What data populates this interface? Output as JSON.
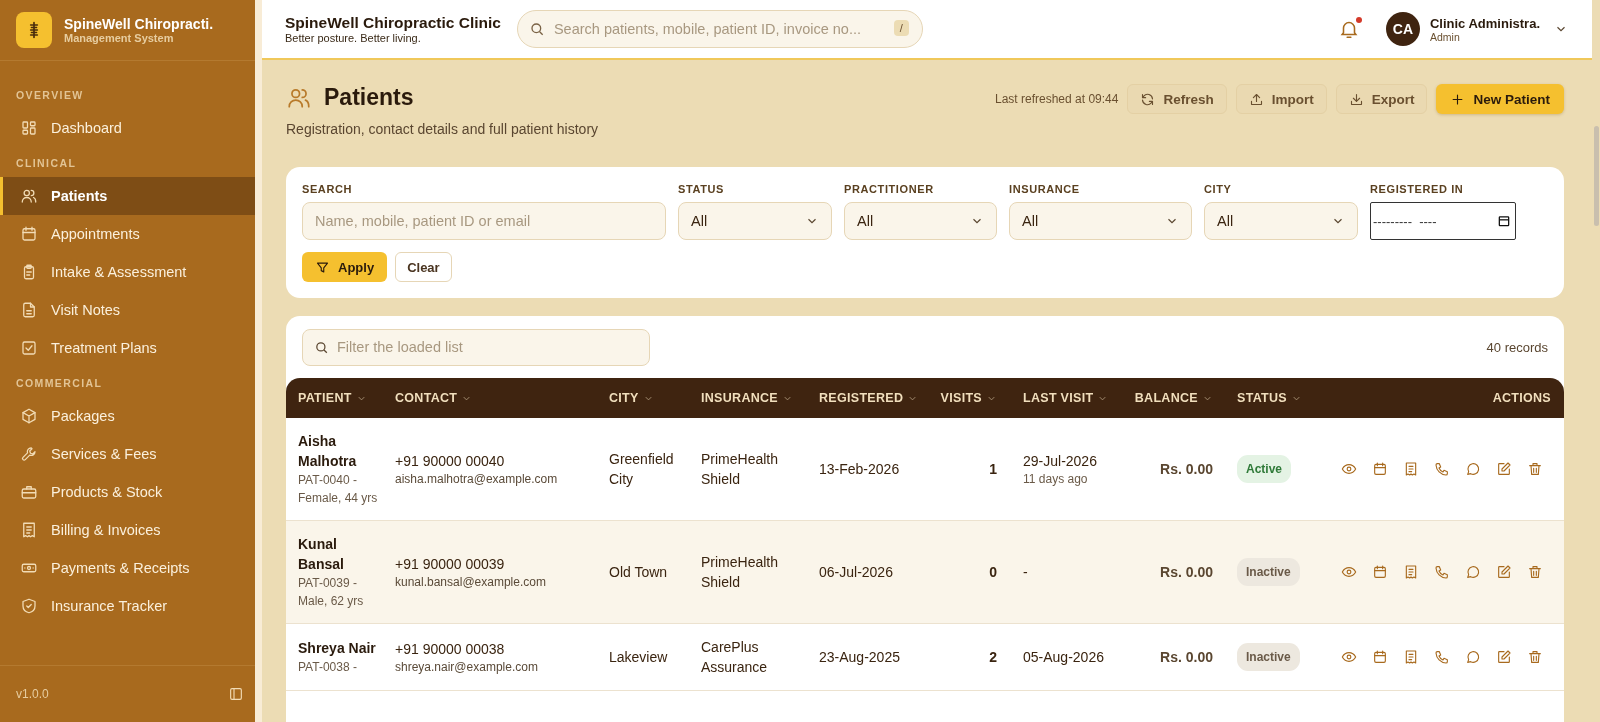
{
  "sidebar": {
    "brand": {
      "title": "SpineWell Chiropracti.",
      "subtitle": "Management System"
    },
    "sections": [
      {
        "heading": "OVERVIEW",
        "items": [
          {
            "label": "Dashboard",
            "selected": false
          }
        ]
      },
      {
        "heading": "CLINICAL",
        "items": [
          {
            "label": "Patients",
            "selected": true
          },
          {
            "label": "Appointments",
            "selected": false
          },
          {
            "label": "Intake & Assessment",
            "selected": false
          },
          {
            "label": "Visit Notes",
            "selected": false
          },
          {
            "label": "Treatment Plans",
            "selected": false
          }
        ]
      },
      {
        "heading": "COMMERCIAL",
        "items": [
          {
            "label": "Packages",
            "selected": false
          },
          {
            "label": "Services & Fees",
            "selected": false
          },
          {
            "label": "Products & Stock",
            "selected": false
          },
          {
            "label": "Billing & Invoices",
            "selected": false
          },
          {
            "label": "Payments & Receipts",
            "selected": false
          },
          {
            "label": "Insurance Tracker",
            "selected": false
          }
        ]
      }
    ],
    "version": "v1.0.0"
  },
  "topbar": {
    "clinic_name": "SpineWell Chiropractic Clinic",
    "tagline": "Better posture. Better living.",
    "search": {
      "placeholder": "Search patients, mobile, patient ID, invoice no...",
      "shortcut": "/"
    },
    "notification_dot": true,
    "user": {
      "initials": "CA",
      "name": "Clinic Administra.",
      "role": "Admin"
    }
  },
  "page": {
    "title": "Patients",
    "subtitle": "Registration, contact details and full patient history",
    "last_refreshed": "Last refreshed at 09:44",
    "actions": [
      {
        "label": "Refresh",
        "kind": "refresh"
      },
      {
        "label": "Import",
        "kind": "import"
      },
      {
        "label": "Export",
        "kind": "export"
      },
      {
        "label": "New Patient",
        "kind": "primary"
      }
    ]
  },
  "filters": {
    "search": {
      "label": "SEARCH",
      "placeholder": "Name, mobile, patient ID or email"
    },
    "selects": [
      {
        "label": "STATUS",
        "value": "All"
      },
      {
        "label": "PRACTITIONER",
        "value": "All"
      },
      {
        "label": "INSURANCE",
        "value": "All"
      },
      {
        "label": "CITY",
        "value": "All"
      }
    ],
    "date": {
      "label": "REGISTERED IN",
      "value": "---------  ----"
    },
    "apply": "Apply",
    "clear": "Clear"
  },
  "list": {
    "filter_placeholder": "Filter the loaded list",
    "count": "40 records",
    "columns": [
      {
        "label": "PATIENT",
        "sortable": true
      },
      {
        "label": "CONTACT",
        "sortable": true
      },
      {
        "label": "CITY",
        "sortable": true
      },
      {
        "label": "INSURANCE",
        "sortable": true
      },
      {
        "label": "REGISTERED",
        "sortable": true
      },
      {
        "label": "VISITS",
        "sortable": true
      },
      {
        "label": "LAST VISIT",
        "sortable": true
      },
      {
        "label": "BALANCE",
        "sortable": true
      },
      {
        "label": "STATUS",
        "sortable": true
      },
      {
        "label": "ACTIONS",
        "sortable": false
      }
    ],
    "rows": [
      {
        "name": "Aisha Malhotra",
        "meta": "PAT-0040 - Female, 44 yrs",
        "phone": "+91 90000 00040",
        "email": "aisha.malhotra@example.com",
        "city": "Greenfield City",
        "insurance": "PrimeHealth Shield",
        "registered": "13-Feb-2026",
        "visits": "1",
        "last_visit": "29-Jul-2026",
        "last_visit_ago": "11 days ago",
        "balance": "Rs. 0.00",
        "status": "Active",
        "active": true
      },
      {
        "name": "Kunal Bansal",
        "meta": "PAT-0039 - Male, 62 yrs",
        "phone": "+91 90000 00039",
        "email": "kunal.bansal@example.com",
        "city": "Old Town",
        "insurance": "PrimeHealth Shield",
        "registered": "06-Jul-2026",
        "visits": "0",
        "last_visit": "-",
        "balance": "Rs. 0.00",
        "status": "Inactive",
        "active": false
      },
      {
        "name": "Shreya Nair",
        "meta": "PAT-0038 -",
        "phone": "+91 90000 00038",
        "email": "shreya.nair@example.com",
        "city": "Lakeview",
        "insurance": "CarePlus Assurance",
        "registered": "23-Aug-2025",
        "visits": "2",
        "last_visit": "05-Aug-2026",
        "balance": "Rs. 0.00",
        "status": "Inactive",
        "active": false
      }
    ]
  }
}
